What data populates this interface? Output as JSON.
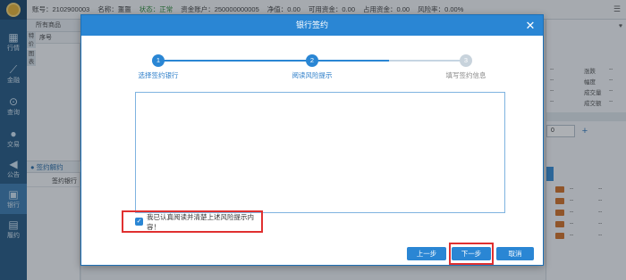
{
  "topbar": {
    "account": "账号：2102900003",
    "name": "名称：噩噩",
    "status": "状态：正常",
    "fund_account": "资金账户：250000000005",
    "net_value": "净值：0.00",
    "available": "可用资金：0.00",
    "occupied": "占用资金：0.00",
    "risk_rate": "风险率：0.00%"
  },
  "sidebar": {
    "items": [
      {
        "label": "行情",
        "icon": "chart-icon"
      },
      {
        "label": "金融",
        "icon": "trend-icon"
      },
      {
        "label": "查询",
        "icon": "query-icon"
      },
      {
        "label": "交易",
        "icon": "user-icon"
      },
      {
        "label": "公告",
        "icon": "megaphone-icon"
      },
      {
        "label": "银行",
        "icon": "bank-icon"
      },
      {
        "label": "履约",
        "icon": "contract-icon"
      }
    ]
  },
  "left_panel": {
    "tab": "所有商品",
    "col1": "序号",
    "vlabel1": "特价",
    "vlabel2": "图表",
    "section_title": "签约解约",
    "row_label": "签约银行"
  },
  "right_panel": {
    "rows": [
      {
        "v": "--",
        "k": "涨跌",
        "k2": "--"
      },
      {
        "v": "--",
        "k": "幅度",
        "k2": "--"
      },
      {
        "v": "--",
        "k": "成交量",
        "k2": "--"
      },
      {
        "v": "--",
        "k": "成交额",
        "k2": "--"
      }
    ],
    "qty_value": "0",
    "list": [
      "--",
      "--",
      "--",
      "--",
      "--"
    ]
  },
  "modal": {
    "title": "银行签约",
    "steps": [
      {
        "num": "1",
        "label": "选择签约银行"
      },
      {
        "num": "2",
        "label": "阅读风险提示"
      },
      {
        "num": "3",
        "label": "填写签约信息"
      }
    ],
    "agree_text": "我已认真阅读并清楚上述风险提示内容！",
    "prev_label": "上一步",
    "next_label": "下一步",
    "cancel_label": "取消"
  },
  "colors": {
    "primary": "#2a86d4",
    "highlight": "#e03030",
    "sidebar": "#2a5d86"
  }
}
